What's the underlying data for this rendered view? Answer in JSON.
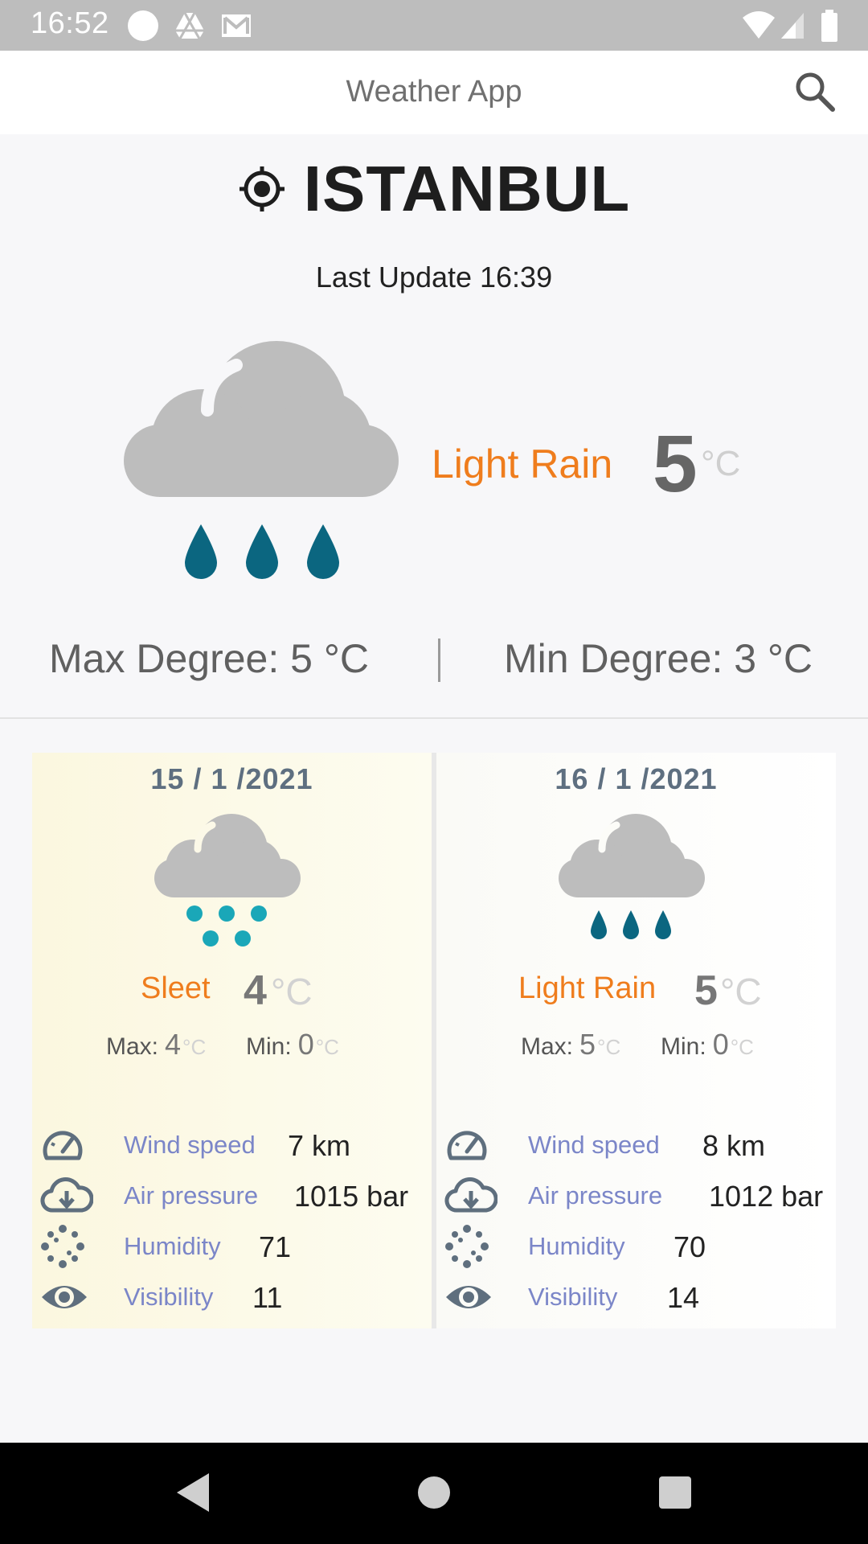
{
  "status_bar": {
    "time": "16:52"
  },
  "app_bar": {
    "title": "Weather App"
  },
  "location": {
    "city": "ISTANBUL",
    "last_update_label": "Last Update",
    "last_update_time": "16:39"
  },
  "current": {
    "condition": "Light Rain",
    "temperature": "5",
    "unit": "°C",
    "max_degree": "Max Degree: 5 °C",
    "min_degree": "Min Degree: 3 °C"
  },
  "forecast": [
    {
      "date": "15 / 1 /2021",
      "condition": "Sleet",
      "icon": "sleet-icon",
      "temperature": "4",
      "unit": "°C",
      "max_label": "Max:",
      "max_value": "4",
      "min_label": "Min:",
      "min_value": "0",
      "small_unit": "°C",
      "details": [
        {
          "icon": "speedometer-icon",
          "label": "Wind speed",
          "value": "7 km"
        },
        {
          "icon": "cloud-download-icon",
          "label": "Air pressure",
          "value": "1015 bar"
        },
        {
          "icon": "humidity-dots-icon",
          "label": "Humidity",
          "value": "71"
        },
        {
          "icon": "eye-icon",
          "label": "Visibility",
          "value": "11"
        }
      ]
    },
    {
      "date": "16 / 1 /2021",
      "condition": "Light Rain",
      "icon": "light-rain-icon",
      "temperature": "5",
      "unit": "°C",
      "max_label": "Max:",
      "max_value": "5",
      "min_label": "Min:",
      "min_value": "0",
      "small_unit": "°C",
      "details": [
        {
          "icon": "speedometer-icon",
          "label": "Wind speed",
          "value": "8 km"
        },
        {
          "icon": "cloud-download-icon",
          "label": "Air pressure",
          "value": "1012 bar"
        },
        {
          "icon": "humidity-dots-icon",
          "label": "Humidity",
          "value": "70"
        },
        {
          "icon": "eye-icon",
          "label": "Visibility",
          "value": "14"
        }
      ]
    }
  ],
  "colors": {
    "accent_orange": "#ef7d1d",
    "label_blue": "#7b86c8",
    "rain_drop": "#0b6680",
    "sleet_dot": "#1aa7b8",
    "cloud_gray": "#bdbdbd"
  }
}
